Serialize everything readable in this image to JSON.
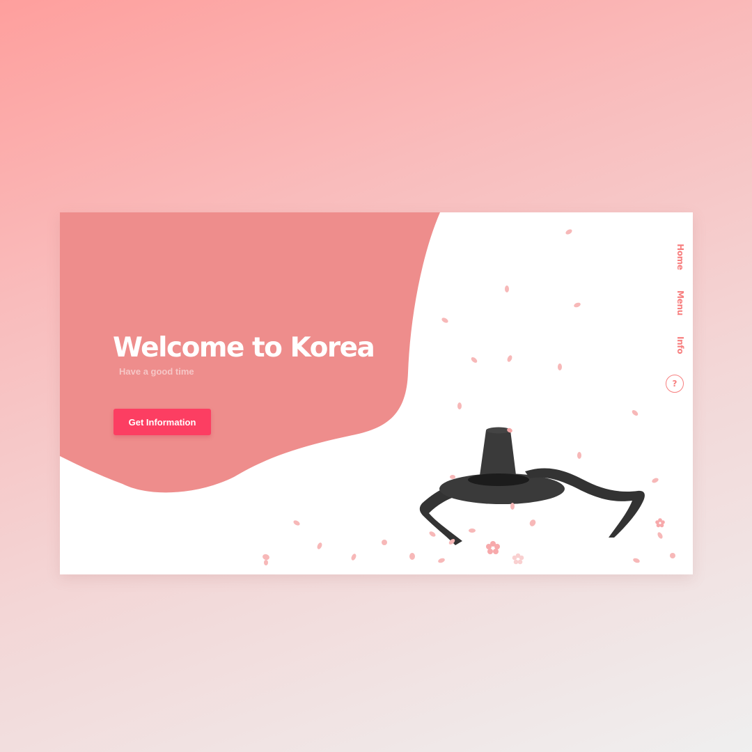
{
  "hero": {
    "title": "Welcome to Korea",
    "subtitle": "Have a good time",
    "cta_label": "Get Information"
  },
  "nav": {
    "items": [
      {
        "label": "Home"
      },
      {
        "label": "Menu"
      },
      {
        "label": "Info"
      }
    ],
    "help_label": "?"
  },
  "icons": {
    "help": "question-circle-icon",
    "illustration": "gat-hat-icon",
    "decoration": "cherry-blossom-petal-icon"
  },
  "colors": {
    "page_gradient_start": "#fe9f9d",
    "page_gradient_end": "#efefef",
    "blob": "#ee8d8c",
    "accent_button": "#fc3e62",
    "nav_text": "#f77f7f",
    "hat": "#3a3a3a",
    "petal": "#f7b8b8"
  }
}
